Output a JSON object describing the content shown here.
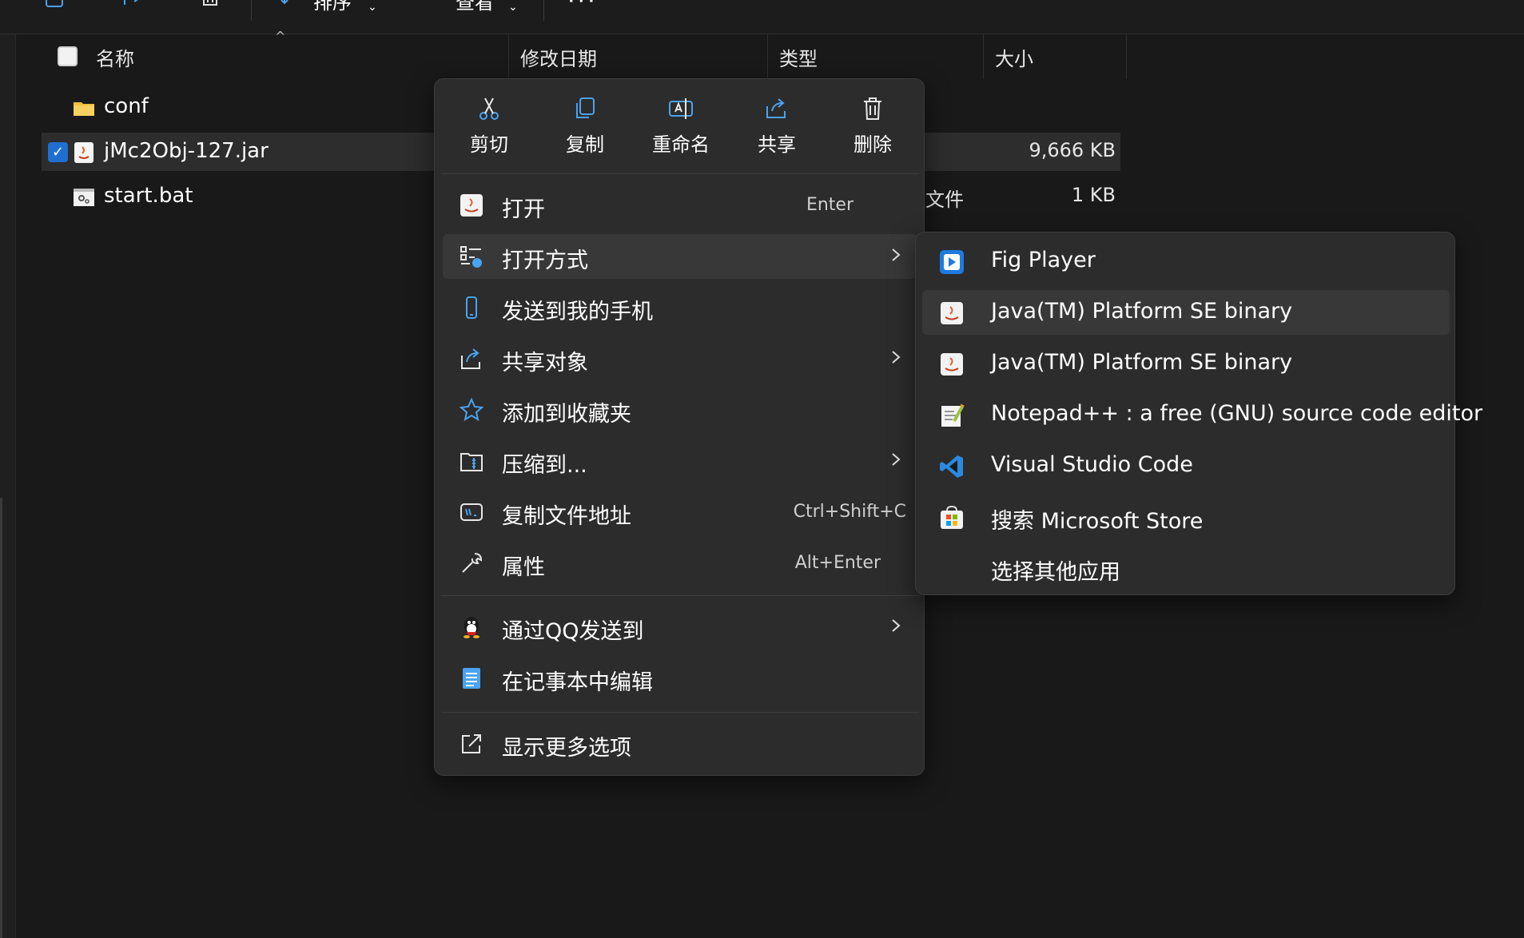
{
  "toolbar": {
    "sort_label": "排序",
    "view_label": "查看",
    "more": "···"
  },
  "header": {
    "name": "名称",
    "modified": "修改日期",
    "type": "类型",
    "size": "大小"
  },
  "files": [
    {
      "name": "conf",
      "type": "",
      "size": ""
    },
    {
      "name": "jMc2Obj-127.jar",
      "type": "",
      "size": "9,666 KB"
    },
    {
      "name": "start.bat",
      "type": "文件",
      "size": "1 KB"
    }
  ],
  "context_menu": {
    "quick_actions": [
      {
        "label": "剪切",
        "icon": "cut-icon"
      },
      {
        "label": "复制",
        "icon": "copy-icon"
      },
      {
        "label": "重命名",
        "icon": "rename-icon"
      },
      {
        "label": "共享",
        "icon": "share-icon"
      },
      {
        "label": "删除",
        "icon": "delete-icon"
      }
    ],
    "items": [
      {
        "label": "打开",
        "shortcut": "Enter"
      },
      {
        "label": "打开方式",
        "shortcut": ""
      },
      {
        "label": "发送到我的手机",
        "shortcut": ""
      },
      {
        "label": "共享对象",
        "shortcut": ""
      },
      {
        "label": "添加到收藏夹",
        "shortcut": ""
      },
      {
        "label": "压缩到...",
        "shortcut": ""
      },
      {
        "label": "复制文件地址",
        "shortcut": "Ctrl+Shift+C"
      },
      {
        "label": "属性",
        "shortcut": "Alt+Enter"
      },
      {
        "label": "通过QQ发送到",
        "shortcut": ""
      },
      {
        "label": "在记事本中编辑",
        "shortcut": ""
      },
      {
        "label": "显示更多选项",
        "shortcut": ""
      }
    ]
  },
  "submenu": {
    "items": [
      {
        "label": "Fig Player"
      },
      {
        "label": "Java(TM) Platform SE binary"
      },
      {
        "label": "Java(TM) Platform SE binary"
      },
      {
        "label": "Notepad++ : a free (GNU) source code editor"
      },
      {
        "label": "Visual Studio Code"
      },
      {
        "label": "搜索 Microsoft Store"
      },
      {
        "label": "选择其他应用"
      }
    ]
  },
  "colors": {
    "background": "#191919",
    "menu_bg": "#2c2c2c",
    "hover_bg": "#383838",
    "accent": "#1f6fd1",
    "folder": "#f0c040"
  }
}
